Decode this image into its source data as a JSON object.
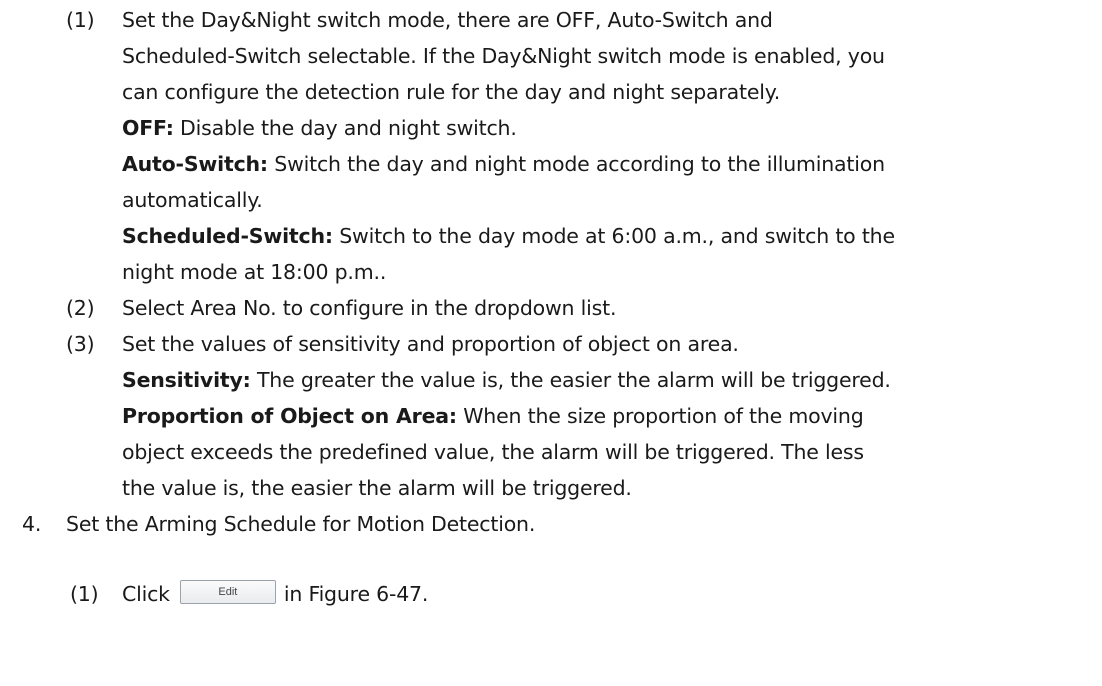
{
  "sub1": {
    "num": "(1)",
    "lines": [
      "Set the Day&Night switch mode, there are OFF, Auto-Switch and",
      "Scheduled-Switch selectable. If the Day&Night switch mode is enabled, you",
      "can configure the detection rule for the day and night separately."
    ],
    "off": {
      "term": "OFF:",
      "text": " Disable the day and night switch."
    },
    "auto": {
      "term": "Auto-Switch:",
      "text": " Switch the day and night mode according to the illumination",
      "cont": "automatically."
    },
    "sched": {
      "term": "Scheduled-Switch:",
      "text": " Switch to the day mode at 6:00 a.m., and switch to the",
      "cont": "night mode at 18:00 p.m.."
    }
  },
  "sub2": {
    "num": "(2)",
    "text": "Select Area No. to configure in the dropdown list."
  },
  "sub3": {
    "num": "(3)",
    "text": "Set the values of sensitivity and proportion of object on area.",
    "sens": {
      "term": "Sensitivity:",
      "text": " The greater the value is, the easier the alarm will be triggered."
    },
    "prop": {
      "term": "Proportion of Object on Area:",
      "text": " When the size proportion of the moving",
      "cont1": "object exceeds the predefined value, the alarm will be triggered. The less",
      "cont2": "the value is, the easier the alarm will be triggered."
    }
  },
  "step4": {
    "num": "4.",
    "text": "Set the Arming Schedule for Motion Detection."
  },
  "sub4_1": {
    "num": "(1)",
    "before": "Click",
    "button_label": "Edit",
    "after": "in Figure 6-47."
  }
}
